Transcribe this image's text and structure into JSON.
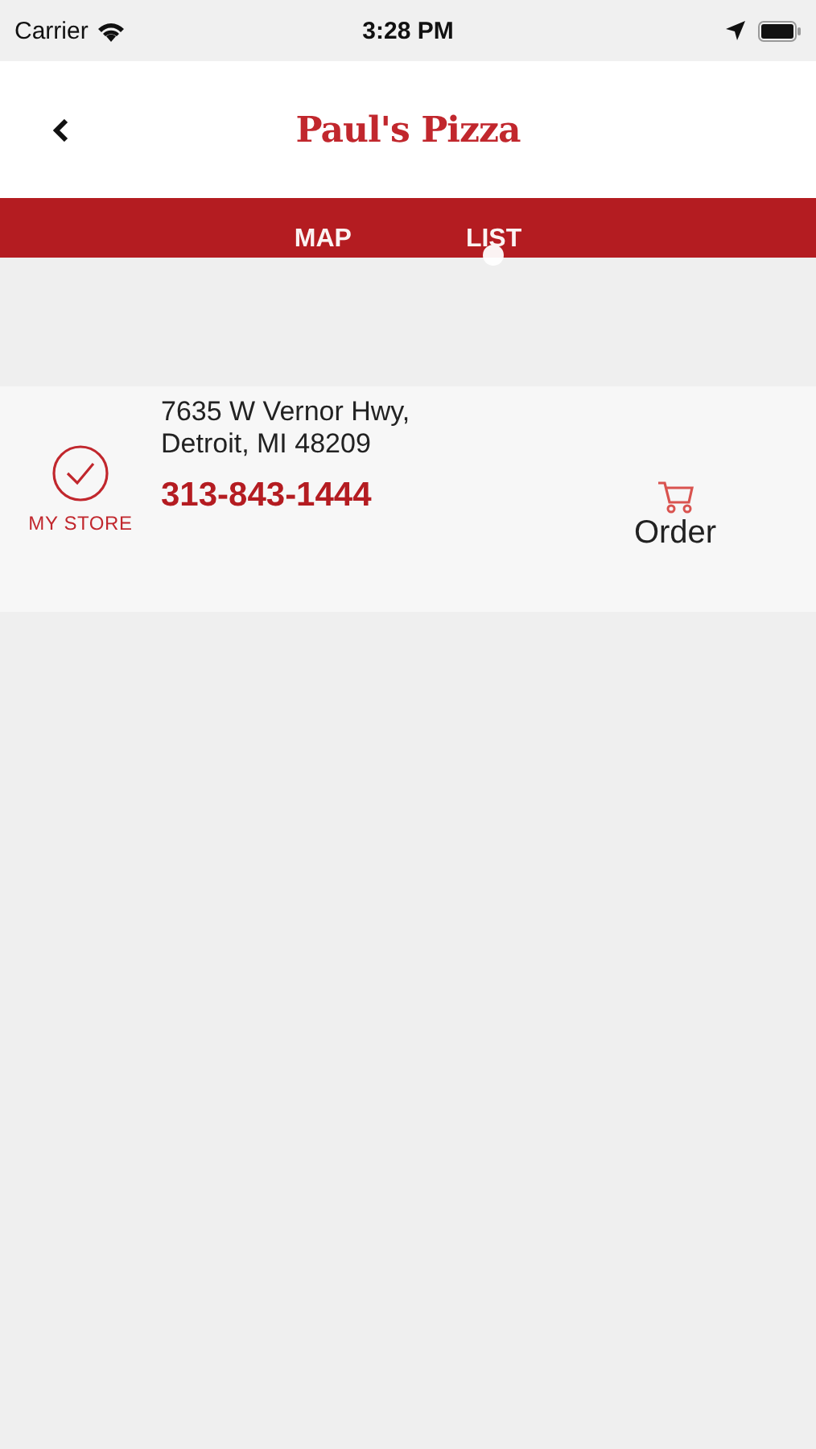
{
  "status_bar": {
    "carrier": "Carrier",
    "time": "3:28 PM"
  },
  "header": {
    "logo": "Paul's Pizza"
  },
  "tabs": [
    {
      "label": "MAP",
      "selected": false
    },
    {
      "label": "LIST",
      "selected": true
    }
  ],
  "stores": [
    {
      "my_store": true,
      "my_store_label": "MY STORE",
      "address_lines": [
        "7635 W Vernor Hwy,",
        "Detroit, MI 48209"
      ],
      "phone": "313-843-1444",
      "order_label": "Order"
    }
  ]
}
